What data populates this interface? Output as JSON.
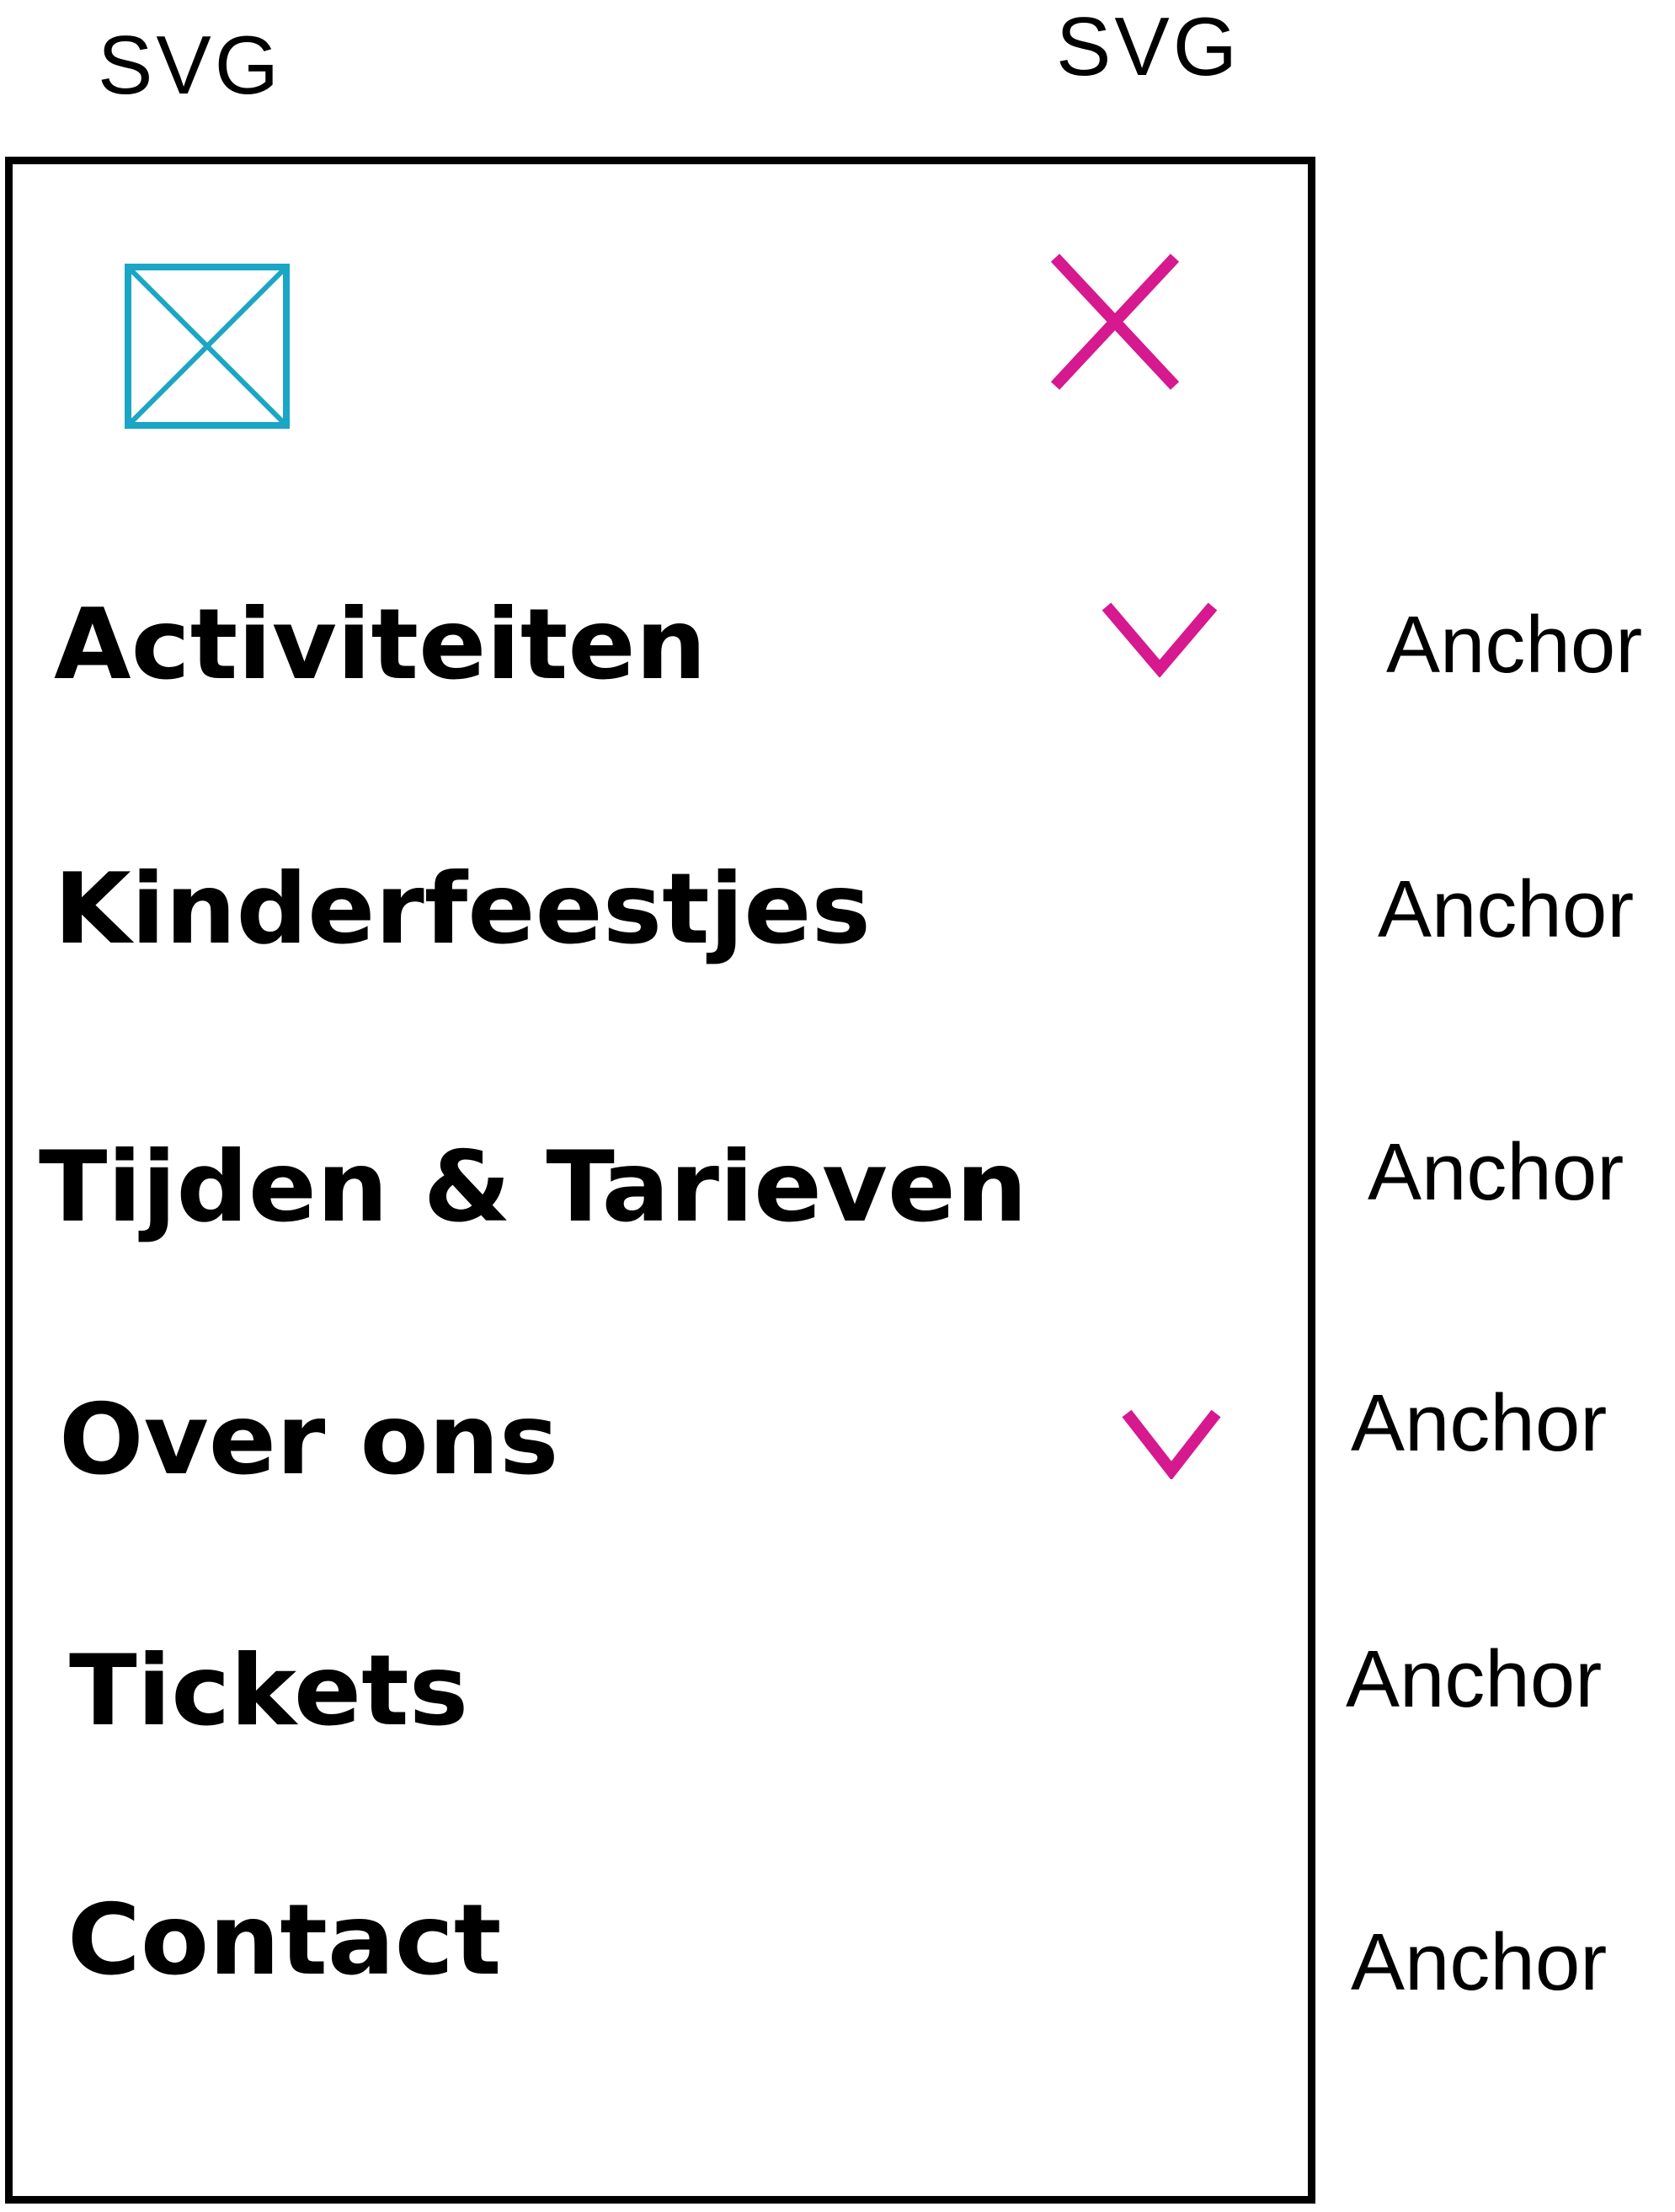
{
  "annotations": {
    "logo_svg": "SVG",
    "close_svg": "SVG",
    "anchor": "Anchor"
  },
  "colors": {
    "logo": "#1aa6c4",
    "accent": "#d6198f",
    "frame": "#000000"
  },
  "icons": {
    "logo": "image-placeholder-icon",
    "close": "close-icon",
    "submenu": "chevron-down-icon"
  },
  "menu": {
    "items": [
      {
        "label": "Activiteiten",
        "has_submenu": true,
        "annotation": "Anchor"
      },
      {
        "label": "Kinderfeestjes",
        "has_submenu": false,
        "annotation": "Anchor"
      },
      {
        "label": "Tijden & Tarieven",
        "has_submenu": false,
        "annotation": "Anchor"
      },
      {
        "label": "Over ons",
        "has_submenu": true,
        "annotation": "Anchor"
      },
      {
        "label": "Tickets",
        "has_submenu": false,
        "annotation": "Anchor"
      },
      {
        "label": "Contact",
        "has_submenu": false,
        "annotation": "Anchor"
      }
    ]
  }
}
